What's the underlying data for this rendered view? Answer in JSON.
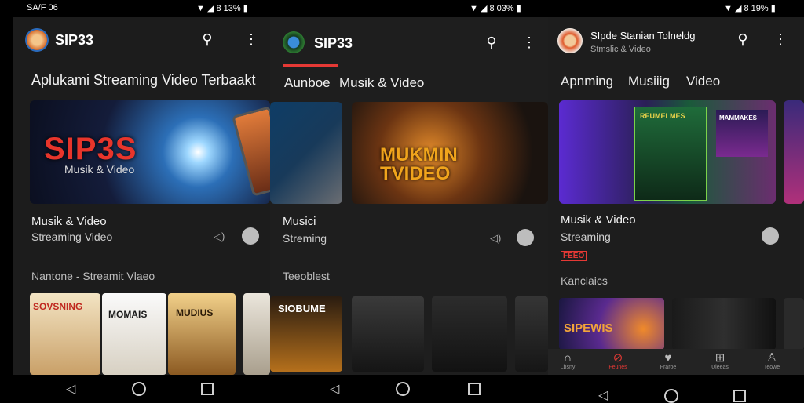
{
  "status_bar": {
    "time": "SA/F 06",
    "left_battery": "8 13%",
    "mid_battery": "8 03%",
    "right_battery": "8 19%"
  },
  "panel1": {
    "app_name": "SIP33",
    "headline": "Aplukami Streaming Video Terbaakt",
    "hero": {
      "big_text": "SIP3S",
      "sub_text": "Musik & Video"
    },
    "meta_title": "Musik & Video",
    "meta_subtitle": "Streaming Video",
    "section_title": "Nantone - Streamit Vlaeo",
    "cards": [
      "SOVSNING",
      "MOMAIS",
      "MUDIUS"
    ]
  },
  "panel2": {
    "app_name": "SIP33",
    "tabs": [
      "Aunboe",
      "Musik & Video"
    ],
    "hero": {
      "big_text": "MUKMIN TVIDEO"
    },
    "meta_title": "Musici",
    "meta_subtitle": "Streming",
    "section_title": "Teeoblest",
    "cards": [
      "SIOBUME"
    ]
  },
  "panel3": {
    "app_name": "SIpde Stanian Tolneldg",
    "app_subtitle": "Stmslic & Video",
    "tabs": [
      "Apnming",
      "Musiiig",
      "Video"
    ],
    "hero": {
      "poster_title": "REUMELMES",
      "poster2_title": "MAMMAKES"
    },
    "meta_title": "Musik & Video",
    "meta_subtitle": "Streaming",
    "badge": "FEEO",
    "section_title": "Kanclaics",
    "cards": [
      "SIPEWIS"
    ],
    "bottom_nav": [
      "Lbsny",
      "Feunes",
      "Fraroe",
      "Uleeas",
      "Teowe"
    ]
  },
  "colors": {
    "accent": "#e53935",
    "background": "#1c1c1c"
  }
}
